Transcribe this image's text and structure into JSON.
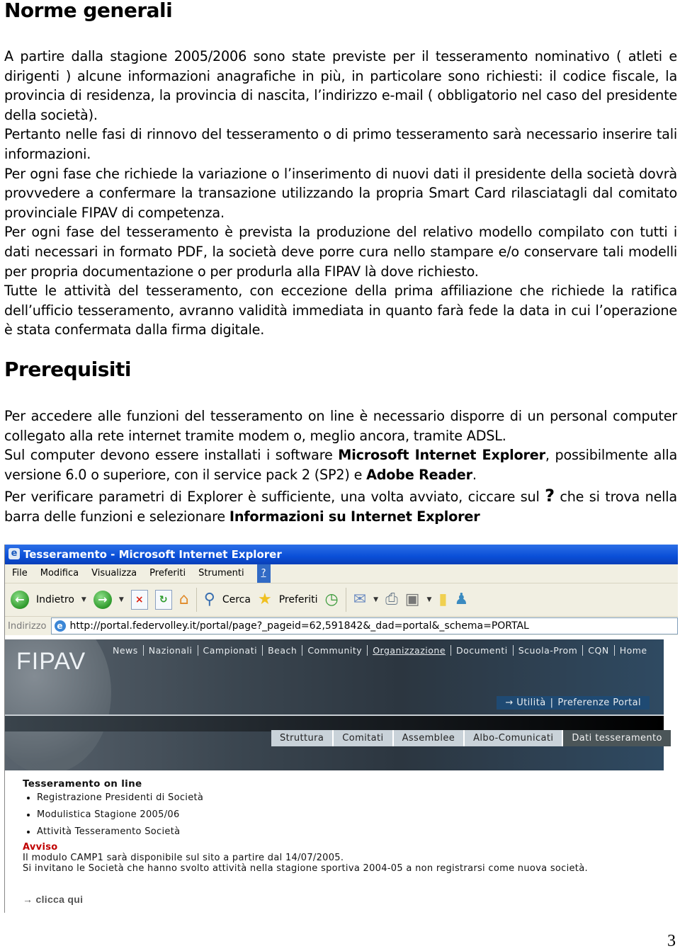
{
  "section1": {
    "title": "Norme generali",
    "paragraphs": [
      "A partire dalla stagione 2005/2006 sono state previste per il tesseramento nominativo ( atleti e dirigenti ) alcune informazioni anagrafiche in più, in particolare sono richiesti: il codice fiscale, la provincia di residenza, la provincia di nascita, l’indirizzo e-mail ( obbligatorio nel caso del presidente della società).",
      "Pertanto nelle fasi di rinnovo del tesseramento o di primo tesseramento sarà necessario inserire tali informazioni.",
      "Per ogni fase che richiede la variazione o l’inserimento di nuovi dati il presidente della società dovrà provvedere a confermare la transazione utilizzando la propria Smart Card rilasciatagli dal comitato provinciale FIPAV di competenza.",
      "Per ogni fase del tesseramento è prevista la produzione del relativo modello compilato con tutti i dati necessari in formato PDF, la società deve porre cura nello stampare e/o conservare tali modelli per propria documentazione o per produrla alla FIPAV là dove richiesto.",
      "Tutte le attività del tesseramento, con eccezione della prima affiliazione che richiede la ratifica dell’ufficio tesseramento, avranno validità immediata in quanto farà fede la data in cui l’operazione è stata confermata dalla firma digitale."
    ]
  },
  "section2": {
    "title": "Prerequisiti",
    "p1": "Per accedere alle funzioni del tesseramento on line è necessario disporre di un personal computer collegato alla rete internet tramite modem o, meglio ancora, tramite ADSL.",
    "p2_before": "Sul computer devono essere installati i software ",
    "p2_bold1": "Microsoft Internet Explorer",
    "p2_mid": ", possibilmente alla versione 6.0 o superiore, con il service pack 2 (SP2) e ",
    "p2_bold2": "Adobe Reader",
    "p2_end": ".",
    "p3_before": "Per verificare parametri di Explorer è sufficiente, una volta avviato, ciccare sul ",
    "p3_qmark": "?",
    "p3_mid": " che si trova nella barra delle funzioni e selezionare ",
    "p3_bold": "Informazioni su Internet Explorer"
  },
  "browser": {
    "title": "Tesseramento - Microsoft Internet Explorer",
    "menu": [
      "File",
      "Modifica",
      "Visualizza",
      "Preferiti",
      "Strumenti",
      "?"
    ],
    "toolbar": {
      "back": "Indietro",
      "search": "Cerca",
      "favorites": "Preferiti"
    },
    "address_label": "Indirizzo",
    "url": "http://portal.federvolley.it/portal/page?_pageid=62,591842&_dad=portal&_schema=PORTAL"
  },
  "site": {
    "logo": "FIPAV",
    "topnav": [
      "News",
      "Nazionali",
      "Campionati",
      "Beach",
      "Community",
      "Organizzazione",
      "Documenti",
      "Scuola-Prom",
      "CQN",
      "Home"
    ],
    "topnav_active": "Organizzazione",
    "utility": [
      "→ Utilità",
      "Preferenze Portal"
    ],
    "subnav": [
      "Struttura",
      "Comitati",
      "Assemblee",
      "Albo-Comunicati",
      "Dati tesseramento"
    ],
    "subnav_selected": "Dati tesseramento",
    "section_title": "Tesseramento on line",
    "links": [
      "Registrazione Presidenti di Società",
      "Modulistica Stagione 2005/06",
      "Attività Tesseramento Società"
    ],
    "warning_title": "Avviso",
    "warning_lines": [
      "Il modulo CAMP1 sarà disponibile sul sito a partire dal 14/07/2005.",
      "Si invitano le Società che hanno svolto attività nella stagione sportiva 2004-05 a non registrarsi come nuova società."
    ],
    "click_here": "→ clicca qui"
  },
  "page_number": "3"
}
